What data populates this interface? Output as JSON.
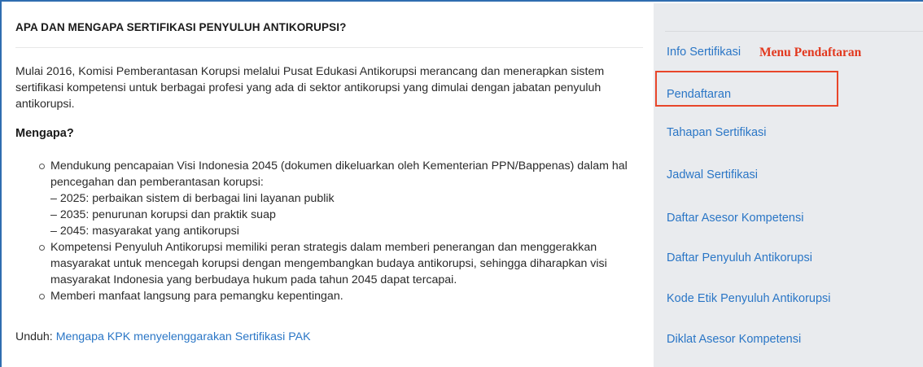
{
  "main": {
    "title": "APA DAN MENGAPA SERTIFIKASI PENYULUH ANTIKORUPSI?",
    "intro": "Mulai 2016, Komisi Pemberantasan Korupsi melalui Pusat Edukasi Antikorupsi merancang dan menerapkan sistem sertifikasi kompetensi untuk berbagai profesi yang ada di sektor antikorupsi yang dimulai dengan jabatan penyuluh antikorupsi.",
    "why_heading": "Mengapa?",
    "bullets": [
      {
        "text": "Mendukung pencapaian Visi Indonesia 2045 (dokumen dikeluarkan oleh Kementerian PPN/Bappenas) dalam hal pencegahan dan pemberantasan korupsi:",
        "sub": [
          "– 2025: perbaikan sistem di berbagai lini layanan publik",
          "– 2035: penurunan korupsi dan praktik suap",
          "– 2045: masyarakat yang antikorupsi"
        ]
      },
      {
        "text": "Kompetensi Penyuluh Antikorupsi memiliki peran strategis dalam memberi penerangan dan menggerakkan masyarakat untuk mencegah korupsi dengan mengembangkan budaya antikorupsi, sehingga diharapkan visi masyarakat Indonesia yang berbudaya hukum pada tahun 2045 dapat tercapai."
      },
      {
        "text": "Memberi manfaat langsung para pemangku kepentingan."
      }
    ],
    "download_label": "Unduh:",
    "download_link": "Mengapa KPK menyelenggarakan Sertifikasi PAK"
  },
  "sidebar": {
    "items": [
      {
        "label": "Info Sertifikasi"
      },
      {
        "label": "Pendaftaran"
      },
      {
        "label": "Tahapan Sertifikasi"
      },
      {
        "label": "Jadwal Sertifikasi"
      },
      {
        "label": "Daftar Asesor Kompetensi"
      },
      {
        "label": "Daftar Penyuluh Antikorupsi"
      },
      {
        "label": "Kode Etik Penyuluh Antikorupsi"
      },
      {
        "label": "Diklat Asesor Kompetensi"
      }
    ],
    "annotation": "Menu Pendaftaran"
  },
  "colors": {
    "link": "#2a76c6",
    "annotation": "#e2381e",
    "sidebar_bg": "#e9ebee",
    "frame": "#2f6db0"
  }
}
